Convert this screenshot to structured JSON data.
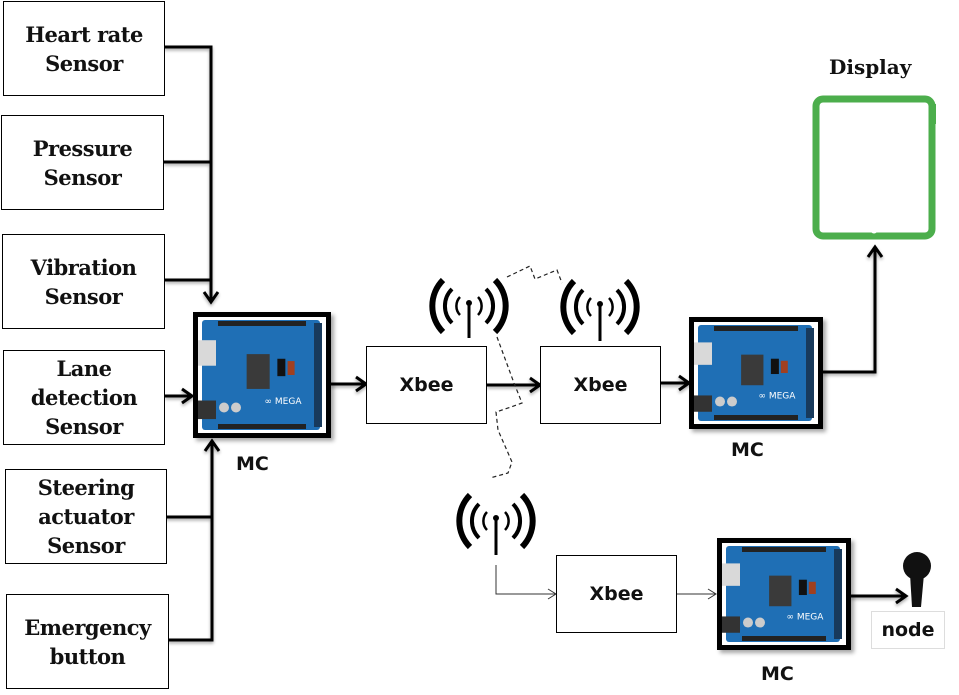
{
  "sensors": [
    {
      "label": "Heart rate\nSensor"
    },
    {
      "label": "Pressure\nSensor"
    },
    {
      "label": "Vibration\nSensor"
    },
    {
      "label": "Lane\ndetection\nSensor"
    },
    {
      "label": "Steering\nactuator\nSensor"
    },
    {
      "label": "Emergency\nbutton"
    }
  ],
  "xbee_modules": [
    {
      "label": "Xbee"
    },
    {
      "label": "Xbee"
    },
    {
      "label": "Xbee"
    }
  ],
  "microcontrollers": [
    {
      "label": "MC",
      "board": "Arduino MEGA"
    },
    {
      "label": "MC",
      "board": "Arduino MEGA"
    },
    {
      "label": "MC",
      "board": "Arduino MEGA"
    }
  ],
  "display": {
    "title": "Display",
    "color": "#4cae4c"
  },
  "node": {
    "label": "node"
  },
  "colors": {
    "board_blue": "#1f6fb5",
    "line": "#000000"
  }
}
